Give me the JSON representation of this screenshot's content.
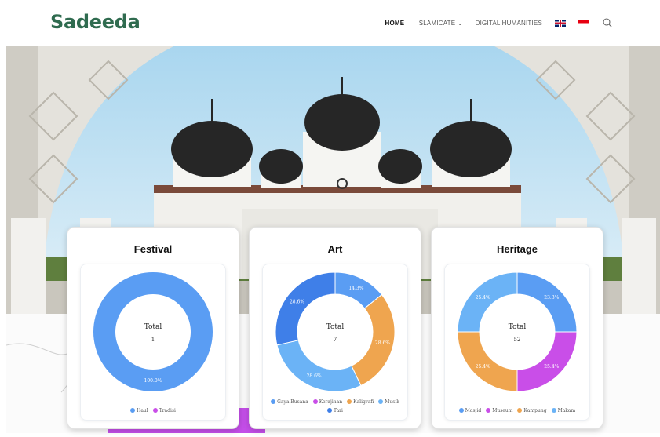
{
  "header": {
    "logo": "Sadeeda",
    "nav": [
      {
        "label": "HOME",
        "active": true
      },
      {
        "label": "ISLAMICATE",
        "has_dropdown": true
      },
      {
        "label": "DIGITAL HUMANITIES"
      }
    ],
    "languages": [
      "uk-flag-icon",
      "indonesia-flag-icon"
    ],
    "search_icon": "search-icon"
  },
  "colors": {
    "brand": "#2f6b4f",
    "blue": "#5a9df3",
    "purple": "#c94ee8",
    "orange": "#efa54f",
    "lightblue": "#6bb3f6",
    "deepblue": "#3f7fe8"
  },
  "cards": [
    {
      "title": "Festival",
      "center_label": "Total",
      "total": "1",
      "chart_data": {
        "type": "pie",
        "slices": [
          {
            "label": "Haul",
            "value": 1,
            "pct_text": "100.0%",
            "color": "#5a9df3"
          },
          {
            "label": "Tradisi",
            "value": 0,
            "pct_text": "",
            "color": "#c94ee8"
          }
        ]
      }
    },
    {
      "title": "Art",
      "center_label": "Total",
      "total": "7",
      "chart_data": {
        "type": "pie",
        "slices": [
          {
            "label": "Gaya Busana",
            "value": 1,
            "pct_text": "14.3%",
            "color": "#5a9df3"
          },
          {
            "label": "Kerajinan",
            "value": 0,
            "pct_text": "",
            "color": "#c94ee8"
          },
          {
            "label": "Kaligrafi",
            "value": 2,
            "pct_text": "28.6%",
            "color": "#efa54f"
          },
          {
            "label": "Musik",
            "value": 2,
            "pct_text": "28.6%",
            "color": "#6bb3f6"
          },
          {
            "label": "Tari",
            "value": 2,
            "pct_text": "28.6%",
            "color": "#3f7fe8"
          }
        ]
      }
    },
    {
      "title": "Heritage",
      "center_label": "Total",
      "total": "52",
      "chart_data": {
        "type": "pie",
        "slices": [
          {
            "label": "Masjid",
            "value": 13,
            "pct_text": "23.3%",
            "color": "#5a9df3"
          },
          {
            "label": "Museum",
            "value": 13,
            "pct_text": "25.4%",
            "color": "#c94ee8"
          },
          {
            "label": "Kampung",
            "value": 13,
            "pct_text": "25.4%",
            "color": "#efa54f"
          },
          {
            "label": "Makam",
            "value": 13,
            "pct_text": "25.4%",
            "color": "#6bb3f6"
          }
        ]
      }
    }
  ]
}
